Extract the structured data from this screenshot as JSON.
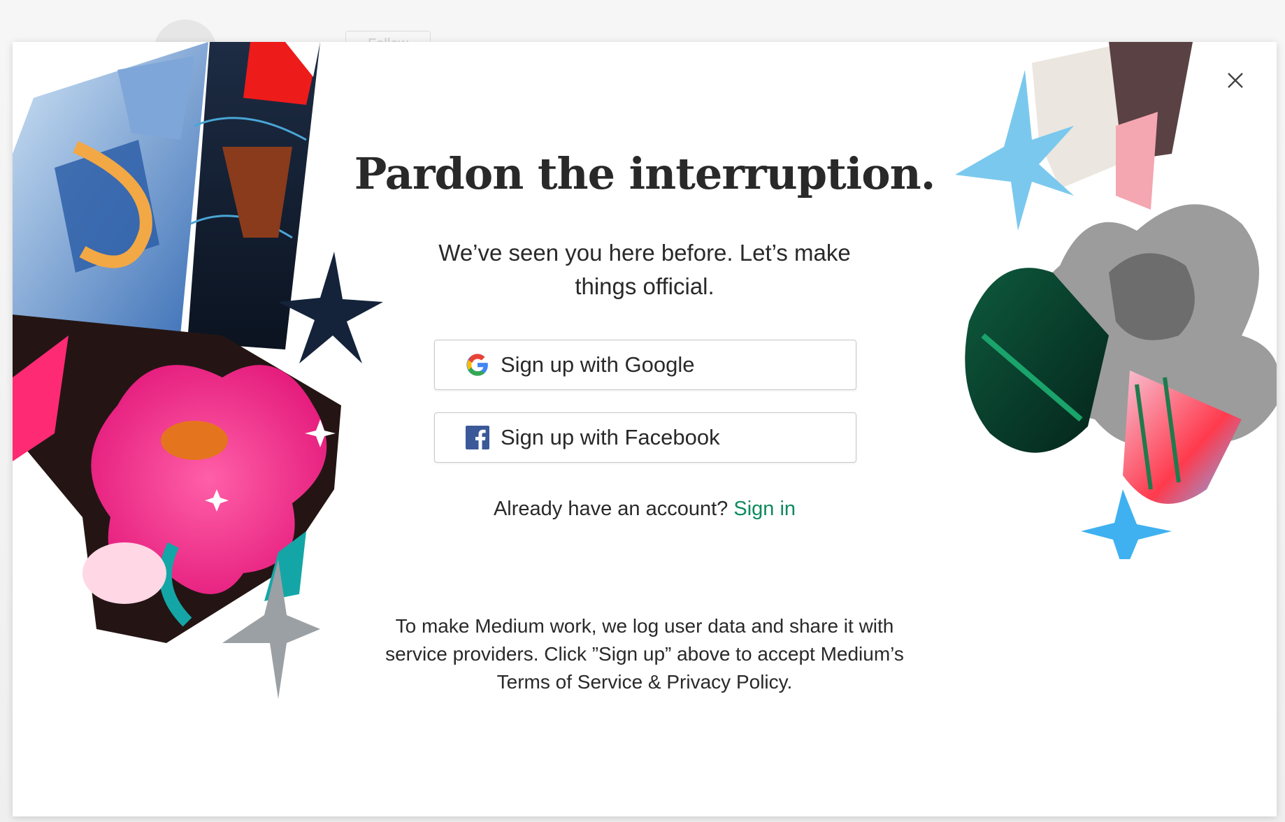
{
  "background": {
    "follow_label": "Follow"
  },
  "modal": {
    "title": "Pardon the interruption.",
    "subtitle": "We’ve seen you here before. Let’s make things official.",
    "google_button_label": "Sign up with Google",
    "facebook_button_label": "Sign up with Facebook",
    "already_text": "Already have an account?",
    "signin_label": "Sign in",
    "legal_text": "To make Medium work, we log user data and share it with service providers. Click ”Sign up” above to accept Medium’s Terms of Service & Privacy Policy."
  },
  "icons": {
    "close": "close-icon",
    "google": "google-icon",
    "facebook": "facebook-icon"
  },
  "colors": {
    "link": "#0f8a5f",
    "text": "#292929",
    "facebook": "#3b5998",
    "pink": "#ff2f8a",
    "teal": "#14a6a6"
  }
}
